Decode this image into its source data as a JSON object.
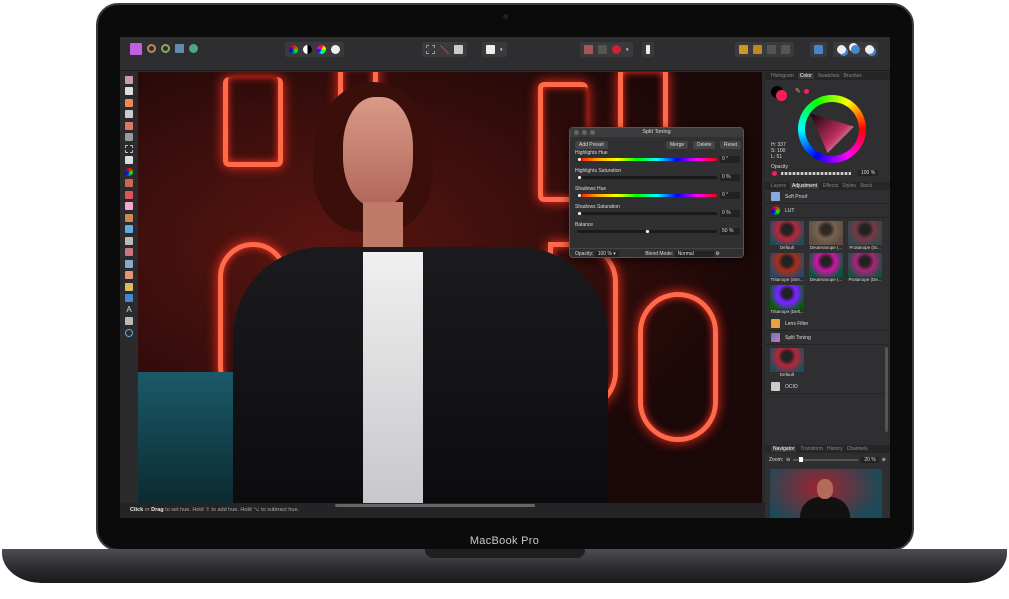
{
  "device": {
    "label": "MacBook Pro"
  },
  "status_bar": {
    "click": "Click",
    "or": " or ",
    "drag": "Drag",
    "rest": " to set hue. Hold ⇧ to add hue. Hold ⌥ to subtract hue."
  },
  "dialog": {
    "title": "Split Toning",
    "add_preset": "Add Preset",
    "merge": "Merge",
    "delete": "Delete",
    "reset": "Reset",
    "sliders": [
      {
        "label": "Highlights Hue",
        "value": "0 °",
        "position": 0,
        "hue": true
      },
      {
        "label": "Highlights Saturation",
        "value": "0 %",
        "position": 0,
        "hue": false
      },
      {
        "label": "Shadows Hue",
        "value": "0 °",
        "position": 0,
        "hue": true
      },
      {
        "label": "Shadows Saturation",
        "value": "0 %",
        "position": 0,
        "hue": false
      },
      {
        "label": "Balance",
        "value": "50 %",
        "position": 50,
        "hue": false
      }
    ],
    "opacity_label": "Opacity:",
    "opacity_value": "100 %",
    "blend_label": "Blend Mode:",
    "blend_value": "Normal"
  },
  "color_panel": {
    "tabs": [
      "Histogram",
      "Color",
      "Swatches",
      "Brushes"
    ],
    "active": "Color",
    "h": "H: 337",
    "s": "S: 100",
    "l": "L: 51",
    "opacity_label": "Opacity",
    "opacity_value": "100 %",
    "color": "#ff1a5a"
  },
  "adjust_panel": {
    "tabs": [
      "Layers",
      "Adjustment",
      "Effects",
      "Styles",
      "Stock"
    ],
    "active": "Adjustment",
    "soft_proof": "Soft Proof",
    "lut": "LUT",
    "lut_presets": [
      "Default",
      "Deuteranope (...",
      "Protanope (Si...",
      "Tritanope (Sim...",
      "Deuteranope (...",
      "Protanope (De...",
      "Tritanope (Delt..."
    ],
    "lens_filter": "Lens Filter",
    "split_toning": "Split Toning",
    "split_presets": [
      "Default"
    ],
    "ocio": "OCIO"
  },
  "navigator": {
    "tabs": [
      "Navigator",
      "Transform",
      "History",
      "Channels"
    ],
    "active": "Navigator",
    "zoom_label": "Zoom:",
    "zoom_value": "20 %"
  }
}
